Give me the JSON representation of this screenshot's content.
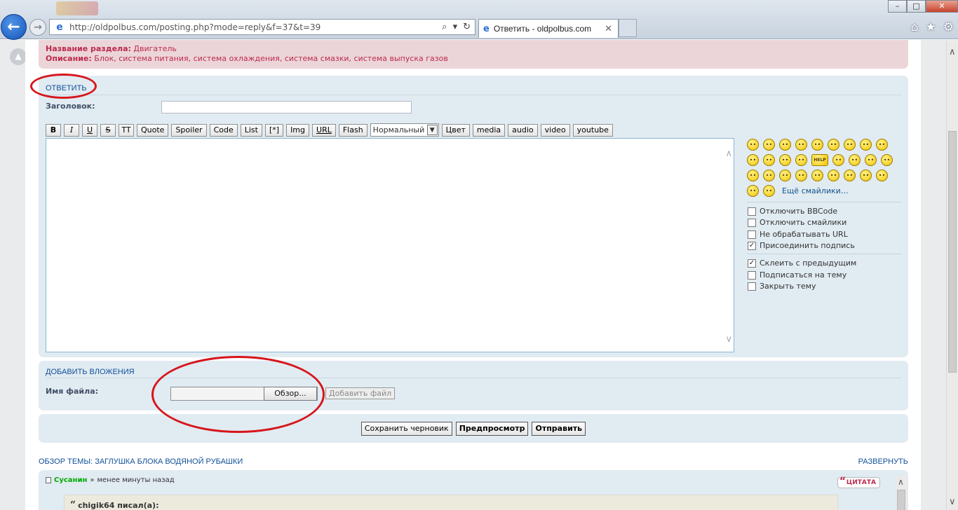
{
  "browser": {
    "url": "http://oldpolbus.com/posting.php?mode=reply&f=37&t=39",
    "tab_title": "Ответить - oldpolbus.com",
    "window_buttons": [
      "–",
      "□",
      "✕"
    ]
  },
  "forum_rules": {
    "section_label": "Название раздела:",
    "section_value": "Двигатель",
    "desc_label": "Описание:",
    "desc_value": "Блок, система питания, система охлаждения, система смазки, система выпуска газов"
  },
  "post_form": {
    "title": "ОТВЕТИТЬ",
    "subject_label": "Заголовок:",
    "subject_value": "",
    "message_value": "",
    "toolbar": {
      "b": "B",
      "i": "I",
      "u": "U",
      "s": "S",
      "tt": "TT",
      "quote": "Quote",
      "spoiler": "Spoiler",
      "code": "Code",
      "list": "List",
      "list_item": "[*]",
      "img": "Img",
      "url": "URL",
      "flash": "Flash",
      "font_size": "Нормальный",
      "color": "Цвет",
      "media": "media",
      "audio": "audio",
      "video": "video",
      "youtube": "youtube"
    },
    "more_smilies": "Ещё смайлики…",
    "smilies_help_label": "HELP",
    "options": [
      {
        "label": "Отключить BBCode",
        "checked": false
      },
      {
        "label": "Отключить смайлики",
        "checked": false
      },
      {
        "label": "Не обрабатывать URL",
        "checked": false
      },
      {
        "label": "Присоединить подпись",
        "checked": true
      },
      {
        "label": "Склеить с предыдущим",
        "checked": true
      },
      {
        "label": "Подписаться на тему",
        "checked": false
      },
      {
        "label": "Закрыть тему",
        "checked": false
      }
    ]
  },
  "attachments": {
    "title": "ДОБАВИТЬ ВЛОЖЕНИЯ",
    "file_label": "Имя файла:",
    "browse": "Обзор...",
    "add_file": "Добавить файл"
  },
  "submit": {
    "save_draft": "Сохранить черновик",
    "preview": "Предпросмотр",
    "send": "Отправить"
  },
  "topic_review": {
    "title": "ОБЗОР ТЕМЫ: ЗАГЛУШКА БЛОКА ВОДЯНОЙ РУБАШКИ",
    "expand": "РАЗВЕРНУТЬ",
    "post": {
      "author": "Сусанин",
      "separator": "»",
      "time": "менее минуты назад",
      "quote_button": "ЦИТАТА",
      "quote_author": "chigik64 писал(а):"
    }
  },
  "colors": {
    "panel_bg": "#e1ebf2",
    "rules_bg": "#ecd5d8",
    "rules_text": "#bc2a4d",
    "link_blue": "#115098",
    "annotation_red": "#d7151b",
    "author_green": "#00aa00"
  },
  "icons": [
    "back-arrow-icon",
    "forward-arrow-icon",
    "ie-icon",
    "search-icon",
    "refresh-icon",
    "home-icon",
    "star-icon",
    "gear-icon",
    "scroll-top-icon"
  ]
}
